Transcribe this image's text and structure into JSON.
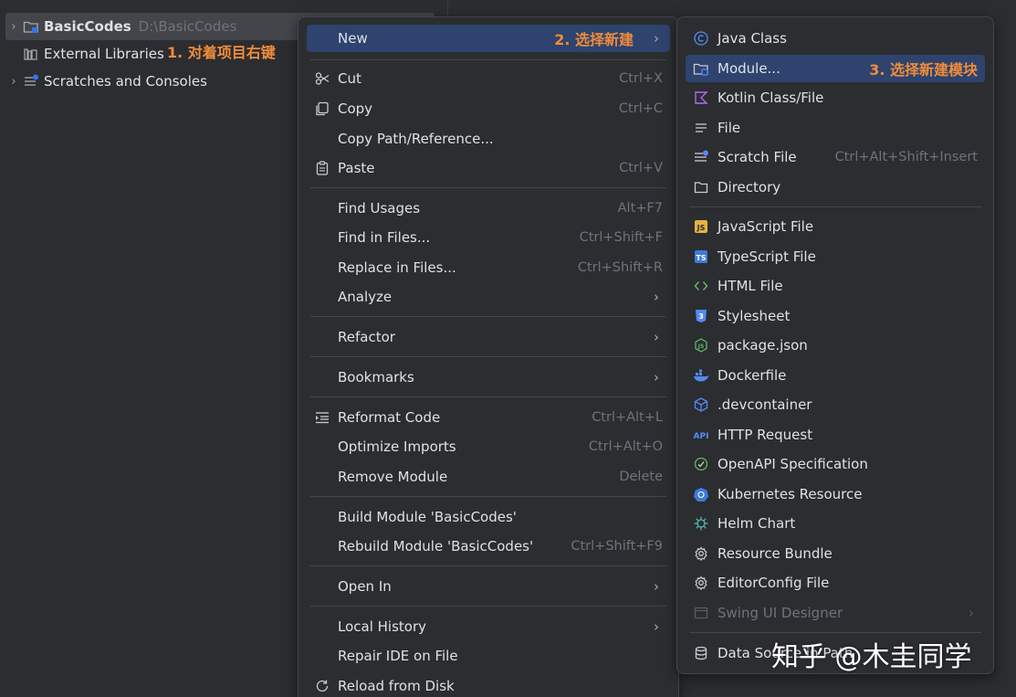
{
  "tree": {
    "rows": [
      {
        "name": "BasicCodes",
        "path": "D:\\BasicCodes",
        "annotation": "1. 对着项目右键"
      },
      {
        "name": "External Libraries"
      },
      {
        "name": "Scratches and Consoles"
      }
    ]
  },
  "main_menu": {
    "new": {
      "label": "New",
      "annotation": "2. 选择新建"
    },
    "cut": {
      "label": "Cut",
      "shortcut": "Ctrl+X"
    },
    "copy": {
      "label": "Copy",
      "shortcut": "Ctrl+C"
    },
    "copy_path": {
      "label": "Copy Path/Reference..."
    },
    "paste": {
      "label": "Paste",
      "shortcut": "Ctrl+V"
    },
    "find_usages": {
      "label": "Find Usages",
      "shortcut": "Alt+F7"
    },
    "find_in_files": {
      "label": "Find in Files...",
      "shortcut": "Ctrl+Shift+F"
    },
    "replace_in_files": {
      "label": "Replace in Files...",
      "shortcut": "Ctrl+Shift+R"
    },
    "analyze": {
      "label": "Analyze"
    },
    "refactor": {
      "label": "Refactor"
    },
    "bookmarks": {
      "label": "Bookmarks"
    },
    "reformat": {
      "label": "Reformat Code",
      "shortcut": "Ctrl+Alt+L"
    },
    "optimize": {
      "label": "Optimize Imports",
      "shortcut": "Ctrl+Alt+O"
    },
    "remove_module": {
      "label": "Remove Module",
      "shortcut": "Delete"
    },
    "build_module": {
      "label": "Build Module 'BasicCodes'"
    },
    "rebuild_module": {
      "label": "Rebuild Module 'BasicCodes'",
      "shortcut": "Ctrl+Shift+F9"
    },
    "open_in": {
      "label": "Open In"
    },
    "local_history": {
      "label": "Local History"
    },
    "repair_ide": {
      "label": "Repair IDE on File"
    },
    "reload": {
      "label": "Reload from Disk"
    }
  },
  "sub_menu": {
    "java_class": {
      "label": "Java Class"
    },
    "module": {
      "label": "Module...",
      "annotation": "3. 选择新建模块"
    },
    "kotlin": {
      "label": "Kotlin Class/File"
    },
    "file": {
      "label": "File"
    },
    "scratch": {
      "label": "Scratch File",
      "shortcut": "Ctrl+Alt+Shift+Insert"
    },
    "directory": {
      "label": "Directory"
    },
    "js": {
      "label": "JavaScript File"
    },
    "ts": {
      "label": "TypeScript File"
    },
    "html": {
      "label": "HTML File"
    },
    "css": {
      "label": "Stylesheet"
    },
    "package_json": {
      "label": "package.json"
    },
    "dockerfile": {
      "label": "Dockerfile"
    },
    "devcontainer": {
      "label": ".devcontainer"
    },
    "http": {
      "label": "HTTP Request"
    },
    "openapi": {
      "label": "OpenAPI Specification"
    },
    "k8s": {
      "label": "Kubernetes Resource"
    },
    "helm": {
      "label": "Helm Chart"
    },
    "resource_bundle": {
      "label": "Resource Bundle"
    },
    "editorconfig": {
      "label": "EditorConfig File"
    },
    "swing": {
      "label": "Swing UI Designer"
    },
    "datasource": {
      "label": "Data Source in Path"
    }
  },
  "watermark": "知乎 @木圭同学",
  "colors": {
    "background": "#2b2d30",
    "highlight": "#2e436e",
    "annotation": "#f08c3a",
    "shortcut": "#6f737a"
  }
}
